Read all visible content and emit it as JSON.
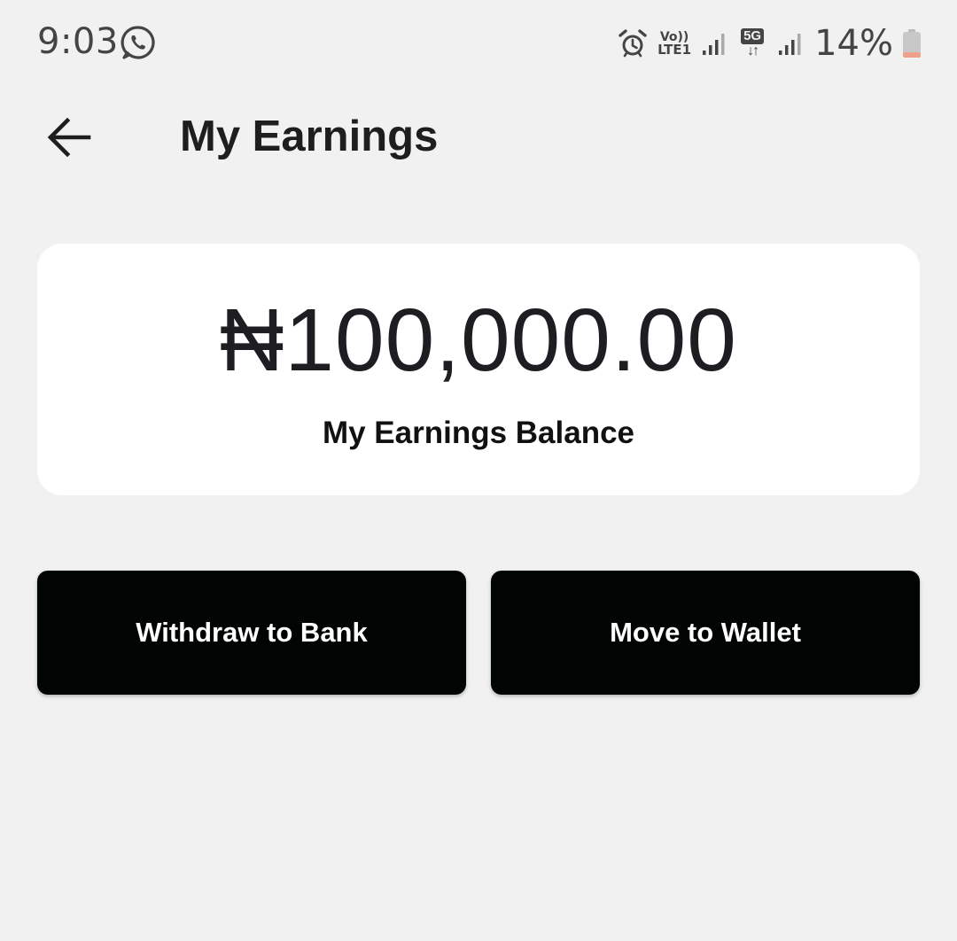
{
  "status_bar": {
    "time": "9:03",
    "volte_top": "Vo))",
    "volte_bottom": "LTE1",
    "network_badge": "5G",
    "network_arrows": "↓↑",
    "battery": "14%",
    "icons": [
      "whatsapp-icon",
      "alarm-icon",
      "volte-icon",
      "signal-icon",
      "5g-icon",
      "signal-icon",
      "battery-icon"
    ]
  },
  "header": {
    "back_icon": "arrow-left-icon",
    "title": "My Earnings"
  },
  "balance_card": {
    "amount": "₦100,000.00",
    "label": "My Earnings Balance"
  },
  "actions": {
    "withdraw_label": "Withdraw to Bank",
    "wallet_label": "Move to Wallet"
  },
  "colors": {
    "background": "#f1f1f1",
    "card": "#ffffff",
    "button": "#000402",
    "button_text": "#ffffff",
    "battery_low": "#f0a08a"
  }
}
